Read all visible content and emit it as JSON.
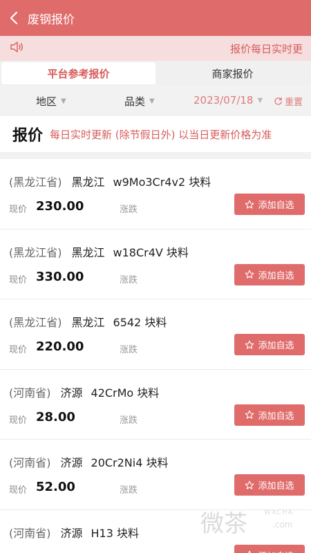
{
  "header": {
    "title": "废钢报价"
  },
  "notice": {
    "text": "报价每日实时更"
  },
  "tabs": [
    {
      "label": "平台参考报价"
    },
    {
      "label": "商家报价"
    }
  ],
  "filters": {
    "region": "地区",
    "category": "品类",
    "date": "2023/07/18",
    "reset": "重置"
  },
  "banner": {
    "title": "报价",
    "subtitle": "每日实时更新 (除节假日外) 以当日更新价格为准"
  },
  "list": {
    "current_label": "现价",
    "change_label": "涨跌",
    "add_label": "添加自选",
    "items": [
      {
        "province": "(黑龙江省)",
        "city": "黑龙江",
        "name": "w9Mo3Cr4v2 块料",
        "price": "230.00"
      },
      {
        "province": "(黑龙江省)",
        "city": "黑龙江",
        "name": "w18Cr4V 块料",
        "price": "330.00"
      },
      {
        "province": "(黑龙江省)",
        "city": "黑龙江",
        "name": "6542 块料",
        "price": "220.00"
      },
      {
        "province": "(河南省)",
        "city": "济源",
        "name": "42CrMo 块料",
        "price": "28.00"
      },
      {
        "province": "(河南省)",
        "city": "济源",
        "name": "20Cr2Ni4 块料",
        "price": "52.00"
      },
      {
        "province": "(河南省)",
        "city": "济源",
        "name": "H13 块料",
        "price": ""
      }
    ]
  },
  "watermark": {
    "text": "微茶",
    "brand": "WXCHA",
    "domain": ".com"
  }
}
